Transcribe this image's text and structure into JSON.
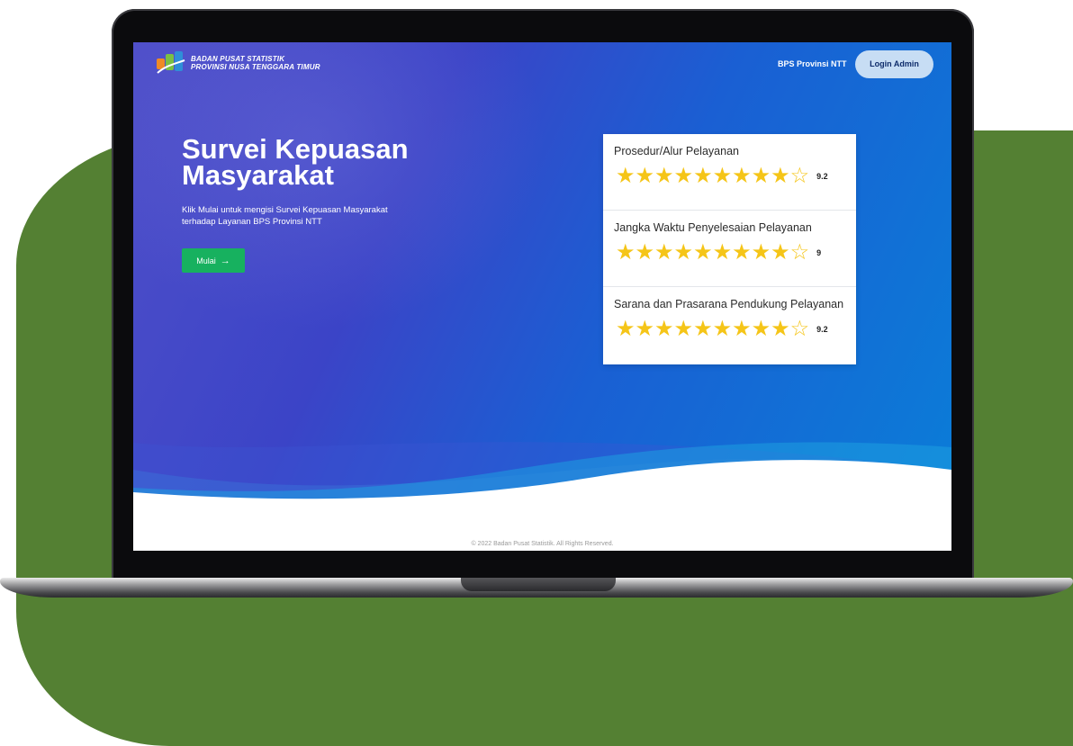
{
  "brand": {
    "line1": "BADAN PUSAT STATISTIK",
    "line2": "PROVINSI NUSA TENGGARA TIMUR"
  },
  "nav": {
    "link": "BPS Provinsi NTT",
    "login": "Login Admin"
  },
  "hero": {
    "title_line1": "Survei Kepuasan",
    "title_line2": "Masyarakat",
    "desc_line1": "Klik Mulai untuk mengisi Survei Kepuasan Masyarakat",
    "desc_line2": "terhadap Layanan BPS Provinsi NTT",
    "button": "Mulai",
    "button_icon": "arrow-right-icon"
  },
  "ratings": [
    {
      "label": "Prosedur/Alur Pelayanan",
      "score": "9.2",
      "filled": 9,
      "total": 10
    },
    {
      "label": "Jangka Waktu Penyelesaian Pelayanan",
      "score": "9",
      "filled": 9,
      "total": 10
    },
    {
      "label": "Sarana dan Prasarana Pendukung Pelayanan",
      "score": "9.2",
      "filled": 9,
      "total": 10
    }
  ],
  "footer": "© 2022 Badan Pusat Statistik. All Rights Reserved.",
  "colors": {
    "accent_green": "#17b15f",
    "star": "#f5c518",
    "frame_green": "#548033",
    "login_bg": "#c7ddf4"
  }
}
